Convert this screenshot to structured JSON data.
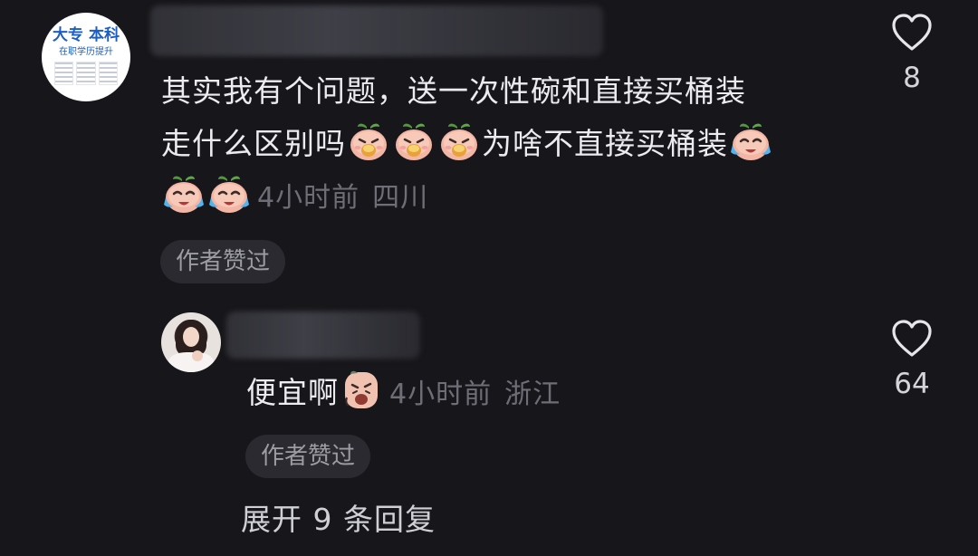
{
  "main_comment": {
    "avatar_ad": {
      "line1": "大专 本科",
      "line2": "在职学历提升"
    },
    "text_line1": "其实我有个问题，送一次性碗和直接买桶装",
    "text_line2a": "走什么区别吗",
    "text_line2b": "为啥不直接买桶装",
    "time": "4小时前",
    "location": "四川",
    "author_liked": "作者赞过",
    "like_count": "8"
  },
  "reply": {
    "text": "便宜啊",
    "time": "4小时前",
    "location": "浙江",
    "author_liked": "作者赞过",
    "like_count": "64"
  },
  "expand_replies": "展开 9 条回复",
  "icons": {
    "heart": "heart-outline-icon",
    "emoji_eating": "eating-peach-emoji",
    "emoji_crying": "crying-peach-emoji",
    "emoji_sad": "sad-face-emoji"
  },
  "colors": {
    "background": "#17171b",
    "text": "#ecebf0",
    "meta": "#6e6e76",
    "chip_bg": "#2a2a30"
  }
}
